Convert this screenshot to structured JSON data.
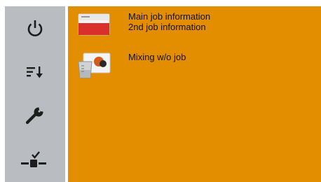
{
  "sidebar": {
    "buttons": [
      {
        "icon": "power-icon"
      },
      {
        "icon": "sort-descending-icon"
      },
      {
        "icon": "wrench-icon"
      },
      {
        "icon": "connection-check-icon"
      }
    ]
  },
  "jobs": [
    {
      "icon": "job-card-icon",
      "line1": "Main job information",
      "line2": "2nd job information"
    },
    {
      "icon": "mixing-icon",
      "line1": "Mixing w/o job"
    }
  ],
  "colors": {
    "sidebar_bg": "#b9bcc0",
    "main_bg": "#e38d00",
    "icon_dark": "#1c1c1c",
    "card_red": "#d9302c"
  }
}
